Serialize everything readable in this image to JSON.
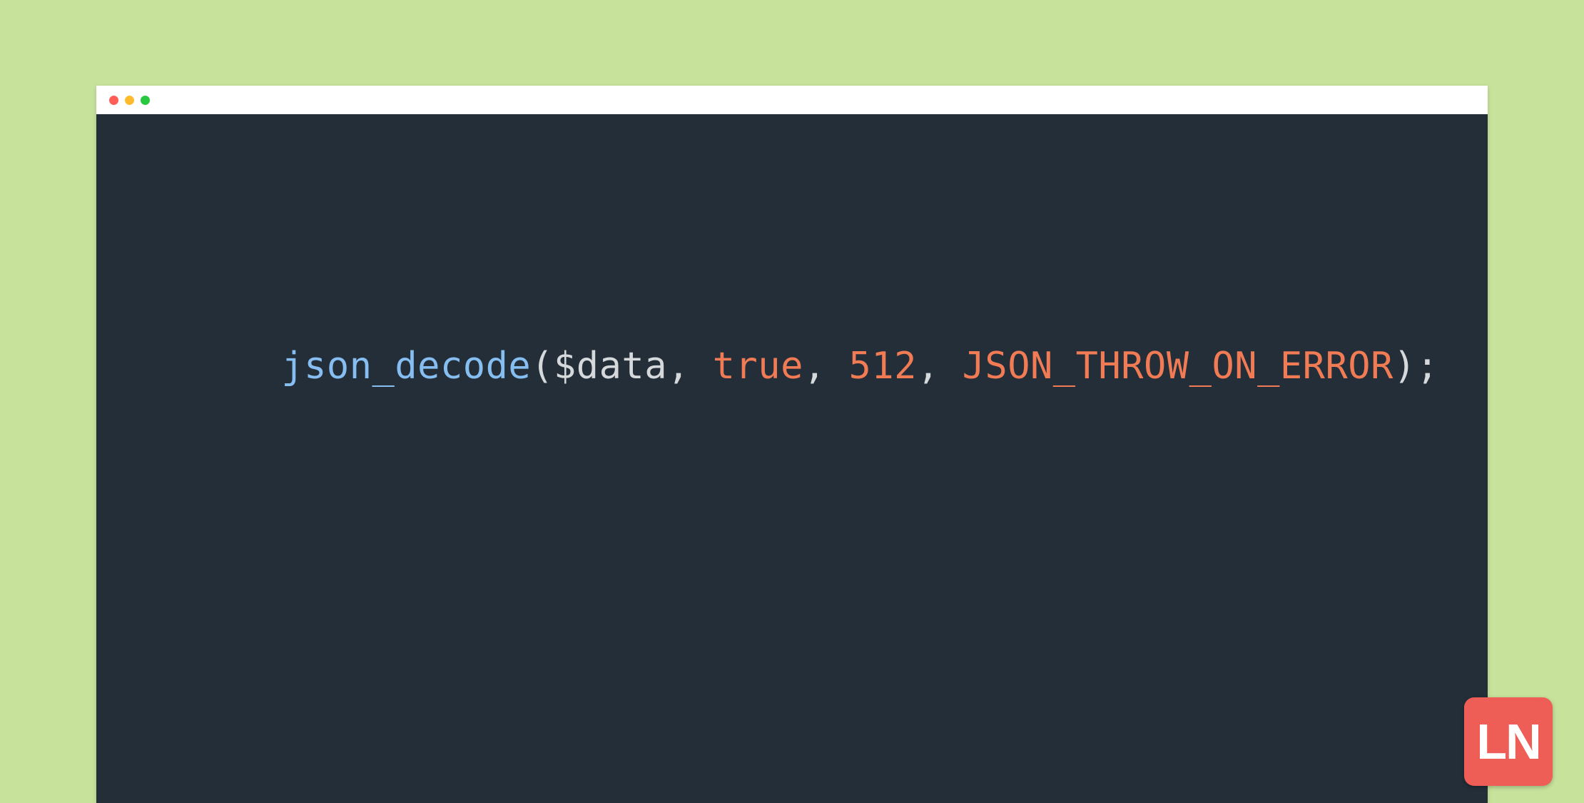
{
  "code": {
    "fn": "json_decode",
    "open": "(",
    "var": "$data",
    "sep": ", ",
    "arg_true": "true",
    "arg_depth": "512",
    "arg_flag": "JSON_THROW_ON_ERROR",
    "close": ");"
  },
  "badge": {
    "text": "LN"
  }
}
